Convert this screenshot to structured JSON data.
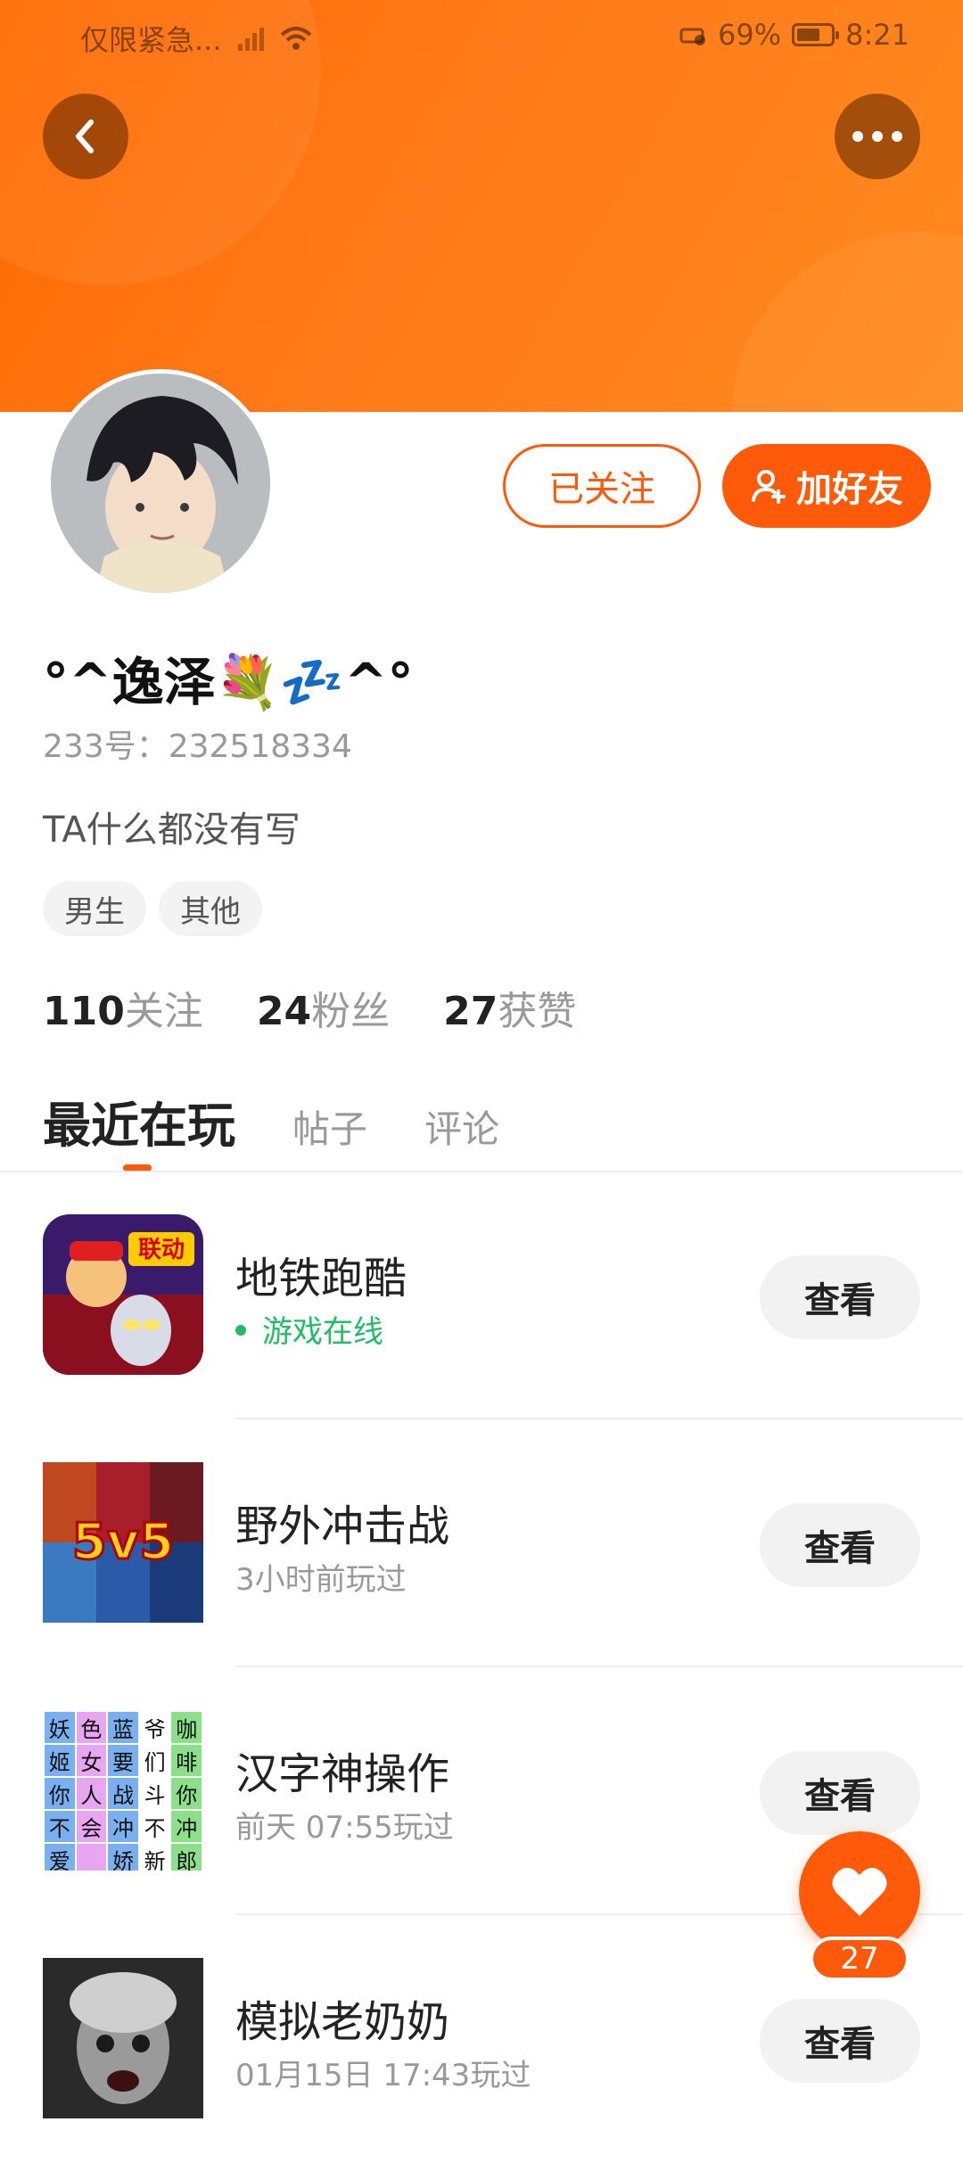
{
  "status_bar": {
    "carrier": "仅限紧急...",
    "battery": "69%",
    "battery_fill": 0.69,
    "time": "8:21"
  },
  "profile": {
    "nickname": "°^逸泽💐💤^°",
    "uid": "233号：232518334",
    "bio": "TA什么都没有写",
    "tags": [
      "男生",
      "其他"
    ],
    "followed_label": "已关注",
    "add_friend_label": "加好友"
  },
  "stats": {
    "following_count": "110",
    "following_label": "关注",
    "fans_count": "24",
    "fans_label": "粉丝",
    "likes_count": "27",
    "likes_label": "获赞"
  },
  "tabs": [
    {
      "label": "最近在玩",
      "active": true
    },
    {
      "label": "帖子",
      "active": false
    },
    {
      "label": "评论",
      "active": false
    }
  ],
  "games": [
    {
      "name": "地铁跑酷",
      "status": "游戏在线",
      "online": true,
      "button": "查看",
      "icon": "subway-surfers-icon"
    },
    {
      "name": "野外冲击战",
      "status": "3小时前玩过",
      "online": false,
      "button": "查看",
      "icon": "5v5-battle-icon"
    },
    {
      "name": "汉字神操作",
      "status": "前天 07:55玩过",
      "online": false,
      "button": "查看",
      "icon": "chinese-character-grid-icon"
    },
    {
      "name": "模拟老奶奶",
      "status": "01月15日 17:43玩过",
      "online": false,
      "button": "查看",
      "icon": "granny-icon"
    }
  ],
  "grid_chars": [
    "妖",
    "色",
    "蓝",
    "爷",
    "咖",
    "姬",
    "女",
    "要",
    "们",
    "啡",
    "你",
    "人",
    "战",
    "斗",
    "你",
    "不",
    "会",
    "冲",
    "不",
    "冲",
    "爱",
    "",
    "娇",
    "新",
    "郎"
  ],
  "like_fab": {
    "count": "27"
  },
  "colors": {
    "accent": "#ff5a0a",
    "online": "#22bb66",
    "header": "#ff7a1a"
  }
}
